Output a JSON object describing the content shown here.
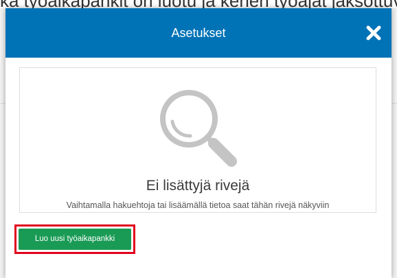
{
  "background": {
    "partial_heading": "ka työaikapankit on luotu ja kenen työajat jaksottuvat kussakin pankissa"
  },
  "dialog": {
    "title": "Asetukset",
    "close_icon": "close-icon",
    "header_color": "#0072b6"
  },
  "empty_state": {
    "icon": "magnifier-icon",
    "title": "Ei lisättyjä rivejä",
    "hint": "Vaihtamalla hakuehtoja tai lisäämällä tietoa saat tähän rivejä näkyviin"
  },
  "actions": {
    "create_label": "Luo uusi työaikapankki",
    "create_color": "#1a9b55",
    "highlight_color": "#e0001b"
  }
}
